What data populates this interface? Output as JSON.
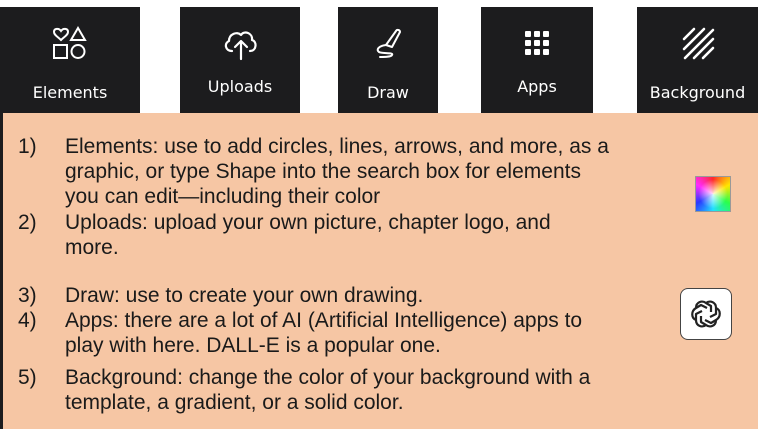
{
  "toolbar": {
    "items": [
      {
        "label": "Elements",
        "icon": "shapes-icon"
      },
      {
        "label": "Uploads",
        "icon": "cloud-upload-icon"
      },
      {
        "label": "Draw",
        "icon": "pen-icon"
      },
      {
        "label": "Apps",
        "icon": "grid-icon"
      },
      {
        "label": "Background",
        "icon": "diagonal-lines-icon"
      }
    ]
  },
  "instructions": {
    "items": [
      {
        "num": "1)",
        "lines": [
          "Elements: use to add circles, lines, arrows, and more, as a",
          "graphic, or type Shape into the search box for elements",
          "you can edit—including their color"
        ]
      },
      {
        "num": "2)",
        "lines": [
          "Uploads: upload your own picture, chapter logo, and",
          "more."
        ]
      },
      {
        "num": "3)",
        "lines": [
          "Draw: use to create your own drawing."
        ]
      },
      {
        "num": "4)",
        "lines": [
          "Apps: there are a lot of AI (Artificial Intelligence) apps to",
          "play with here. DALL-E is a popular one."
        ]
      },
      {
        "num": "5)",
        "lines": [
          "Background: change the color of your background with a",
          "template, a gradient, or a solid color."
        ]
      }
    ]
  },
  "colors": {
    "tile_bg": "#1c1c1e",
    "panel_bg": "#f6c6a4",
    "text": "#1a1a1a"
  },
  "decor": {
    "color_swatch_icon": "color-wheel-icon",
    "app_logo_icon": "openai-logo-icon"
  }
}
